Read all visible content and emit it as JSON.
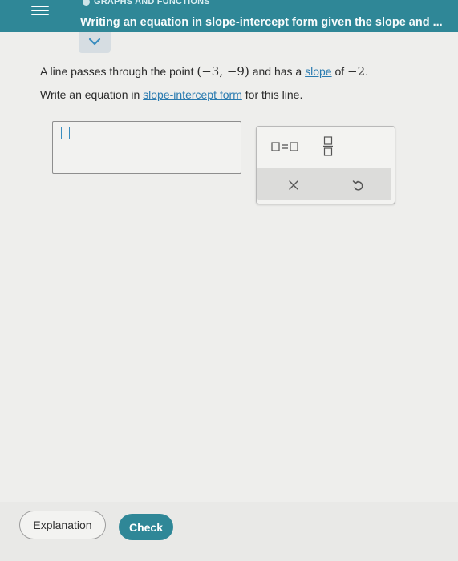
{
  "header": {
    "category": "GRAPHS AND FUNCTIONS",
    "lesson_title": "Writing an equation in slope-intercept form given the slope and ...",
    "menu_icon": "hamburger-menu-icon",
    "collapse_icon": "chevron-down-icon"
  },
  "problem": {
    "text_before": "A line passes through the point ",
    "point": "(−3,  −9)",
    "text_middle": " and has a ",
    "slope_link": "slope",
    "text_after": " of ",
    "slope_value": "−2",
    "period": ".",
    "instruction_before": "Write an equation in ",
    "instruction_link": "slope-intercept form",
    "instruction_after": " for this line."
  },
  "keypad": {
    "equation_key_icon": "box-equals-box-icon",
    "fraction_key_icon": "fraction-icon",
    "clear_key_icon": "close-icon",
    "undo_key_icon": "undo-icon"
  },
  "footer": {
    "explanation_label": "Explanation",
    "check_label": "Check"
  },
  "colors": {
    "header_bg": "#2f8797",
    "link": "#2a7bb0",
    "check_button": "#2f8797",
    "cursor_box": "#3a8dbf"
  }
}
